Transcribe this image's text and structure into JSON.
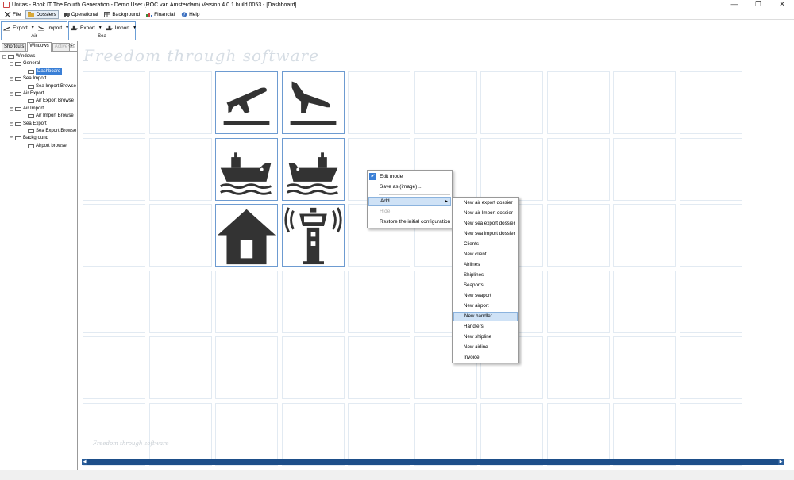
{
  "window": {
    "title": "Unitas - Book IT The Fourth Generation - Demo User (ROC van Amsterdam)  Version 4.0.1 build 0053 - [Dashboard]",
    "controls": [
      "—",
      "❐",
      "✕"
    ]
  },
  "menubar": {
    "items": [
      {
        "label": "File",
        "icon": "tools-icon"
      },
      {
        "label": "Dossiers",
        "icon": "folder-icon",
        "selected": true
      },
      {
        "label": "Operational",
        "icon": "truck-icon"
      },
      {
        "label": "Background",
        "icon": "table-icon"
      },
      {
        "label": "Financial",
        "icon": "chart-icon"
      },
      {
        "label": "Help",
        "icon": "help-icon"
      }
    ]
  },
  "ribbon": {
    "groups": [
      {
        "label": "Air",
        "buttons": [
          {
            "label": "Export",
            "icon": "plane-takeoff-icon"
          },
          {
            "label": "Import",
            "icon": "plane-landing-icon"
          }
        ]
      },
      {
        "label": "Sea",
        "buttons": [
          {
            "label": "Export",
            "icon": "ship-icon"
          },
          {
            "label": "Import",
            "icon": "ship-icon"
          }
        ]
      }
    ]
  },
  "left_panel": {
    "tabs": [
      {
        "label": "Shortcuts",
        "state": "normal"
      },
      {
        "label": "Windows",
        "state": "active"
      },
      {
        "label": "Active",
        "state": "disabled"
      }
    ],
    "tree": [
      {
        "label": "Windows",
        "level": 0,
        "expander": "−",
        "icon": "network-icon"
      },
      {
        "label": "General",
        "level": 1,
        "expander": "−",
        "icon": "folder-icon"
      },
      {
        "label": "Dashboard",
        "level": 2,
        "selected": true,
        "icon": "window-icon"
      },
      {
        "label": "Sea Import",
        "level": 1,
        "expander": "−",
        "icon": "ship-icon"
      },
      {
        "label": "Sea Import Browse",
        "level": 2,
        "icon": "window-icon"
      },
      {
        "label": "Air Export",
        "level": 1,
        "expander": "−",
        "icon": "plane-takeoff-icon"
      },
      {
        "label": "Air Export Browse",
        "level": 2,
        "icon": "window-icon"
      },
      {
        "label": "Air Import",
        "level": 1,
        "expander": "−",
        "icon": "plane-landing-icon"
      },
      {
        "label": "Air Import Browse",
        "level": 2,
        "icon": "window-icon"
      },
      {
        "label": "Sea Export",
        "level": 1,
        "expander": "−",
        "icon": "ship-icon"
      },
      {
        "label": "Sea Export Browse",
        "level": 2,
        "icon": "window-icon"
      },
      {
        "label": "Background",
        "level": 1,
        "expander": "−",
        "icon": "table-icon"
      },
      {
        "label": "Airport browse",
        "level": 2,
        "icon": "window-icon"
      }
    ]
  },
  "dashboard": {
    "watermark": "Freedom through software",
    "watermark_small": "Freedom through software",
    "tiles": [
      {
        "icon": "air-export-icon",
        "row": 0,
        "col": 2
      },
      {
        "icon": "air-import-icon",
        "row": 0,
        "col": 3
      },
      {
        "icon": "sea-export-icon",
        "row": 1,
        "col": 2
      },
      {
        "icon": "sea-import-icon",
        "row": 1,
        "col": 3
      },
      {
        "icon": "home-icon",
        "row": 2,
        "col": 2
      },
      {
        "icon": "control-tower-icon",
        "row": 2,
        "col": 3
      }
    ]
  },
  "context_menu": {
    "items": [
      {
        "label": "Edit mode",
        "checked": true
      },
      {
        "label": "Save as (image)..."
      },
      {
        "separator": true
      },
      {
        "label": "Add",
        "submenu": true,
        "highlighted": true
      },
      {
        "label": "Hide",
        "disabled": true
      },
      {
        "label": "Restore the initial configuration"
      }
    ]
  },
  "submenu": {
    "items": [
      "New air export dossier",
      "New air Import dossier",
      "New sea export dossier",
      "New sea import dossier",
      "Clients",
      "New client",
      "Airlines",
      "Shiplines",
      "Seaports",
      "New seaport",
      "New airport",
      "New handler",
      "Handlers",
      "New shipline",
      "New airline",
      "Invoice"
    ],
    "highlighted": "New handler"
  },
  "colors": {
    "accent": "#3a7fd6",
    "scrollbar": "#1d4e89",
    "tile_border_active": "#6d9bd1",
    "tile_border": "#e2eaf2",
    "icon_fill": "#333333"
  }
}
